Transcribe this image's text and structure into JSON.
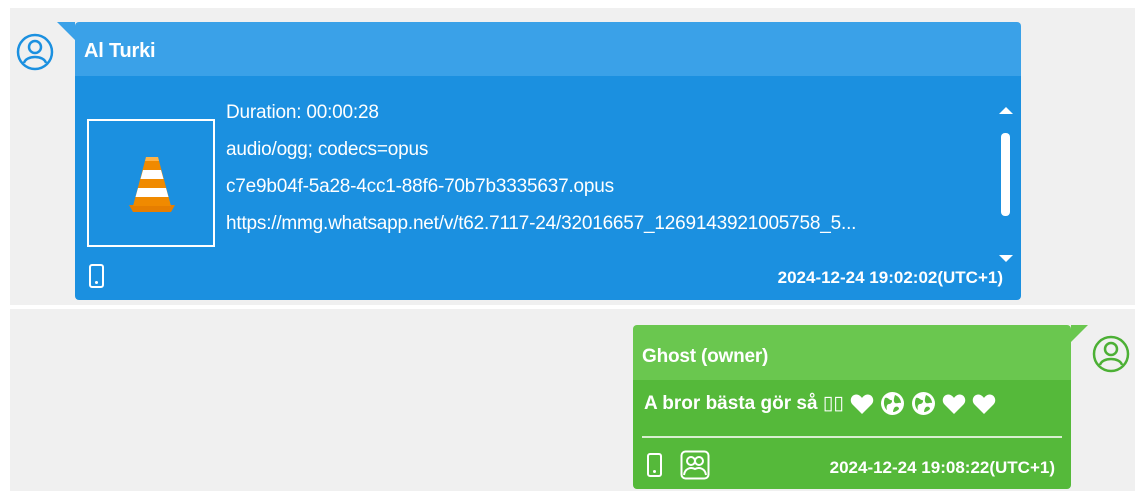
{
  "messages": [
    {
      "sender": "Al Turki",
      "attachment": {
        "icon": "vlc-cone-icon",
        "duration": "Duration: 00:00:28",
        "mime": "audio/ogg; codecs=opus",
        "filename": "c7e9b04f-5a28-4cc1-88f6-70b7b3335637.opus",
        "url": "https://mmg.whatsapp.net/v/t62.7117-24/32016657_1269143921005758_5..."
      },
      "timestamp": "2024-12-24 19:02:02(UTC+1)",
      "device_icon": "phone-icon",
      "colors": {
        "header": "#3aa1e8",
        "body": "#1b90e0"
      }
    },
    {
      "sender": "Ghost (owner)",
      "text": "A bror bästa gör så ▯▯",
      "emojis": [
        "heart-icon",
        "globe-icon",
        "globe-icon",
        "heart-icon",
        "heart-icon"
      ],
      "timestamp": "2024-12-24 19:08:22(UTC+1)",
      "device_icon": "phone-icon",
      "extra_icon": "group-icon",
      "colors": {
        "header": "#6ac74f",
        "body": "#55b93a"
      }
    }
  ]
}
